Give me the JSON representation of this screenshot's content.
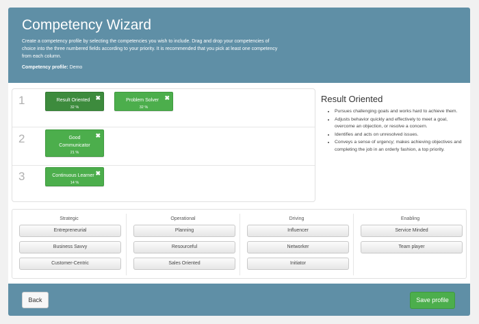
{
  "header": {
    "title": "Competency Wizard",
    "description": "Create a competency profile by selecting the competencies you wish to include. Drag and drop your competencies of choice into the three numbered fields according to your priority. It is recommended that you pick at least one competency from each column.",
    "profile_label": "Competency profile:",
    "profile_value": "Demo"
  },
  "slots": [
    {
      "number": "1",
      "chips": [
        {
          "label": "Result Oriented",
          "pct": "32 %",
          "close": "✖"
        },
        {
          "label": "Problem Solver",
          "pct": "32 %",
          "close": "✖"
        }
      ]
    },
    {
      "number": "2",
      "chips": [
        {
          "label": "Good Communicator",
          "pct": "21 %",
          "close": "✖"
        }
      ]
    },
    {
      "number": "3",
      "chips": [
        {
          "label": "Continuous Learner",
          "pct": "14 %",
          "close": "✖"
        }
      ]
    }
  ],
  "detail": {
    "title": "Result Oriented",
    "bullets": [
      "Pursues challenging goals and works hard to achieve them.",
      "Adjusts behavior quickly and effectively to meet a goal, overcome an objection, or resolve a concern.",
      "Identifies and acts on unresolved issues.",
      "Conveys a sense of urgency; makes achieving objectives and completing the job in an orderly fashion, a top priority."
    ]
  },
  "columns": [
    {
      "heading": "Strategic",
      "items": [
        "Entrepreneurial",
        "Business Savvy",
        "Customer-Centric"
      ]
    },
    {
      "heading": "Operational",
      "items": [
        "Planning",
        "Resourceful",
        "Sales Oriented"
      ]
    },
    {
      "heading": "Driving",
      "items": [
        "Influencer",
        "Networker",
        "Initiator"
      ]
    },
    {
      "heading": "Enabling",
      "items": [
        "Service Minded",
        "Team player"
      ]
    }
  ],
  "footer": {
    "back_label": "Back",
    "save_label": "Save profile"
  },
  "colors": {
    "header_bg": "#5f8fa6",
    "chip_green": "#4cae4c",
    "chip_selected": "#3d8b3d"
  }
}
